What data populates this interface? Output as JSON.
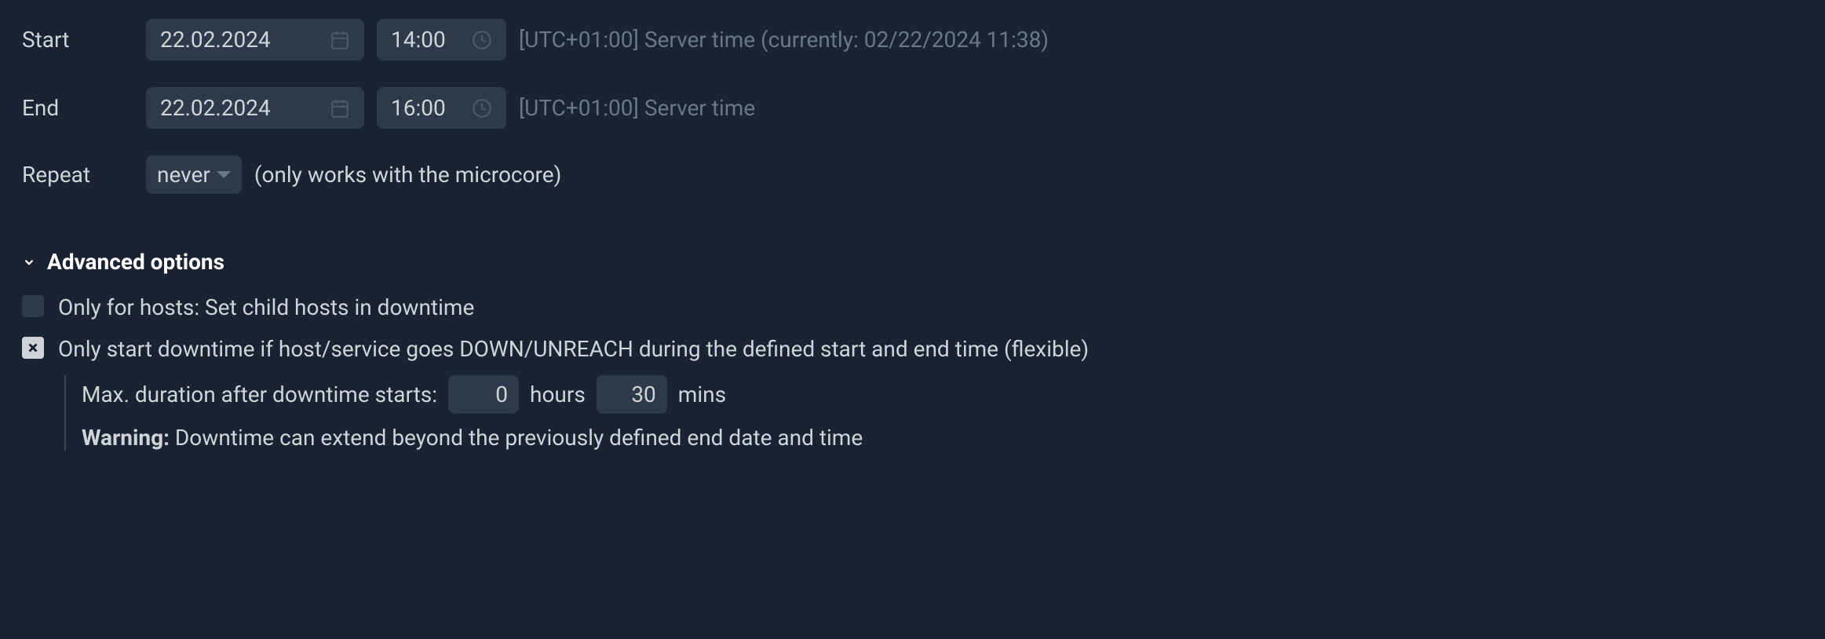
{
  "start": {
    "label": "Start",
    "date": "22.02.2024",
    "time": "14:00",
    "help": "[UTC+01:00] Server time (currently: 02/22/2024 11:38)"
  },
  "end": {
    "label": "End",
    "date": "22.02.2024",
    "time": "16:00",
    "help": "[UTC+01:00] Server time"
  },
  "repeat": {
    "label": "Repeat",
    "value": "never",
    "note": "(only works with the microcore)"
  },
  "advanced": {
    "title": "Advanced options",
    "child_hosts": {
      "label": "Only for hosts: Set child hosts in downtime",
      "checked": false
    },
    "flexible": {
      "label": "Only start downtime if host/service goes DOWN/UNREACH during the defined start and end time (flexible)",
      "checked": true
    },
    "duration": {
      "label": "Max. duration after downtime starts:",
      "hours": "0",
      "hours_unit": "hours",
      "mins": "30",
      "mins_unit": "mins"
    },
    "warning": {
      "label": "Warning:",
      "text": " Downtime can extend beyond the previously defined end date and time"
    }
  }
}
